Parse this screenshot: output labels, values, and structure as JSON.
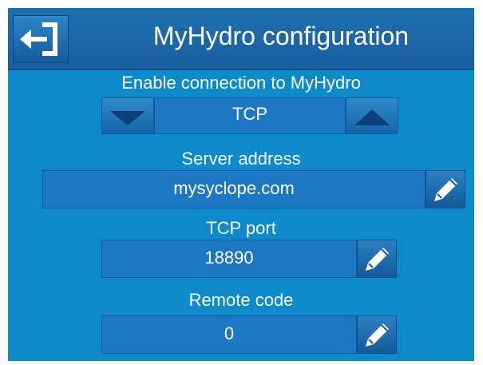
{
  "header": {
    "title": "MyHydro configuration",
    "back_icon": "exit-arrow-icon"
  },
  "connection": {
    "label": "Enable connection to MyHydro",
    "value": "TCP",
    "prev_icon": "triangle-down-icon",
    "next_icon": "triangle-up-icon"
  },
  "server": {
    "label": "Server address",
    "value": "mysyclope.com",
    "edit_icon": "pencil-icon"
  },
  "port": {
    "label": "TCP port",
    "value": "18890",
    "edit_icon": "pencil-icon"
  },
  "remote": {
    "label": "Remote code",
    "value": "0",
    "edit_icon": "pencil-icon"
  },
  "colors": {
    "background": "#0c8ac9",
    "header": "#1a63a5",
    "field": "#1d78c3",
    "text": "#ffffff"
  }
}
